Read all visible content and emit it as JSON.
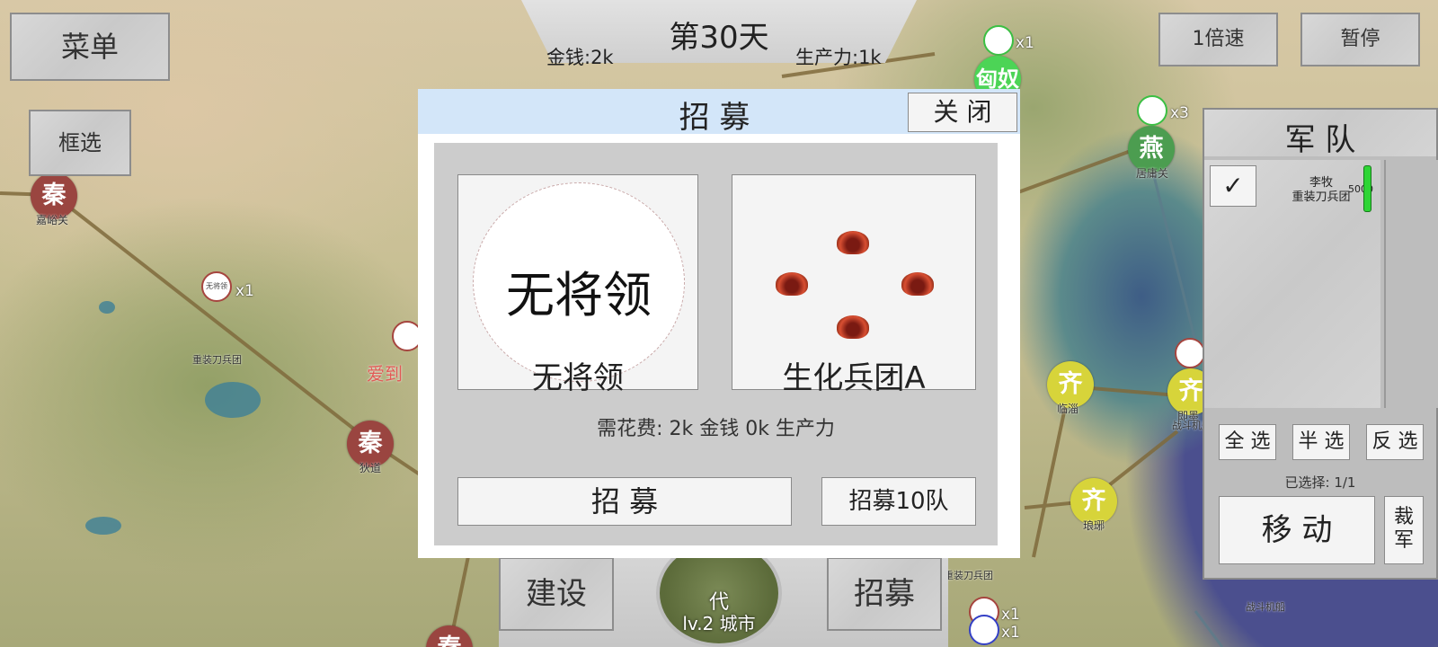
{
  "top": {
    "day": "第30天",
    "money": "金钱:2k",
    "production": "生产力:1k"
  },
  "buttons": {
    "menu": "菜单",
    "select_box": "框选",
    "speed": "1倍速",
    "pause": "暂停",
    "build": "建设",
    "recruit_bottom": "招募"
  },
  "modal": {
    "title": "招 募",
    "close": "关 闭",
    "general_icon_text": "无将领",
    "general_label": "无将领",
    "unit_label": "生化兵团A",
    "cost": "需花费: 2k 金钱 0k 生产力",
    "recruit": "招 募",
    "recruit10": "招募10队"
  },
  "army": {
    "title": "军 队",
    "unit_general": "李牧",
    "unit_type": "重装刀兵团",
    "unit_strength": "5000",
    "unit_strength_fraction": 1.0,
    "select_all": "全 选",
    "select_half": "半 选",
    "select_invert": "反 选",
    "selected": "已选择: 1/1",
    "move": "移 动",
    "disband": "裁军"
  },
  "bottom_city": {
    "name": "代",
    "level": "lv.2 城市"
  },
  "map": {
    "cities": [
      {
        "glyph": "秦",
        "name": "嘉峪关",
        "color": "#9a4540"
      },
      {
        "glyph": "秦",
        "name": "狄道",
        "color": "#9a4540"
      },
      {
        "glyph": "秦",
        "name": ""
      },
      {
        "glyph": "燕",
        "name": "居庸关",
        "color": "#4c9d50"
      },
      {
        "glyph": "匈奴",
        "name": "",
        "color": "#4cd456"
      },
      {
        "glyph": "齐",
        "name": "临淄",
        "color": "#d7d43a"
      },
      {
        "glyph": "齐",
        "name": "即墨",
        "color": "#d7d43a"
      },
      {
        "glyph": "齐",
        "name": "琅琊",
        "color": "#d7d43a"
      }
    ],
    "labels": {
      "unit_general": "无将领",
      "unit_type1": "重装刀兵团",
      "unit_type2": "重装刀兵团",
      "unit_type3": "战斗机船",
      "unit_type4": "战斗机船",
      "red_text": "爱到",
      "c1": "x1",
      "c2": "x1",
      "c3": "x3",
      "c4": "x1",
      "c5": "x1"
    }
  }
}
